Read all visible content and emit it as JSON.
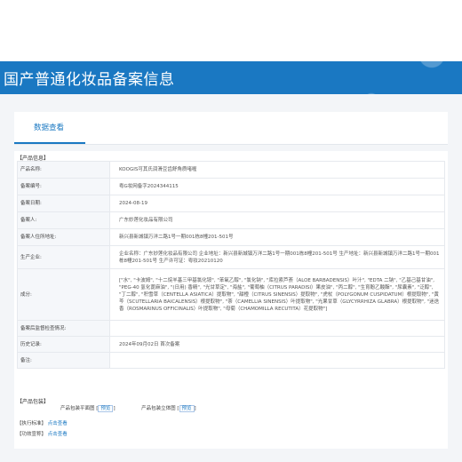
{
  "header": {
    "title": "国产普通化妆品备案信息"
  },
  "tab": {
    "label": "数据查看"
  },
  "sections": {
    "product_info": "【产品信息】",
    "packaging": "【产品包装】",
    "standard": "【执行标准】",
    "efficacy": "【功效宣称】"
  },
  "info_rows": [
    {
      "label": "产品名称:",
      "value": "KOOGIS可其氏润滑豆齿舒角质啫喱"
    },
    {
      "label": "备案编号:",
      "value": "粤G妆网备字2024344115"
    },
    {
      "label": "备案日期:",
      "value": "2024-08-19"
    },
    {
      "label": "备案人:",
      "value": "广东妙莲化妆品有限公司"
    },
    {
      "label": "备案人住所地址:",
      "value": "新兴县新城镇万洋二路1号一期001栋8幢201-501号"
    },
    {
      "label": "生产企业:",
      "value": "企业名称：广东妙莲化妆品有限公司 企业地址：新兴县新城镇万洋二路1号一期001栋8幢201-501号 生产地址：新兴县新城镇万洋二路1号一期001栋8幢201-501号 生产许可证：粤妆20210120"
    },
    {
      "label": "成分:",
      "value": "[\"水\", \"卡波姆\", \"十二烷羊基三甲基氯化铵\", \"苯氧乙醇\", \"氯化钠\", \"库拉索芦荟（ALOE BARBADENSIS）叶汁\", \"EDTA 二钠\", \"乙基己基甘油\", \"PEG-40 氢化蓖麻油\", \"(日用) 香精\", \"光甘草定\", \"海盐\", \"葡萄柚（CITRUS PARADISI）果皮油\", \"丙二醇\", \"生育酚乙酸酯\", \"尿囊素\", \"泛醇\", \"丁二醇\", \"积雪草（CENTELLA ASIATICA）提取物\", \"甜橙（CITRUS SINENSIS）提取物\", \"虎杖（POLYGONUM CUSPIDATUM）根提取物\", \"黄芩（SCUTELLARIA BAICALENSIS）根提取物\", \"茶（CAMELLIA SINENSIS）叶提取物\", \"光果甘草（GLYCYRRHIZA GLABRA）根提取物\", \"迷迭香（ROSMARINUS OFFICINALIS）叶提取物\", \"母菊（CHAMOMILLA RECUTITA）花提取物\"]"
    },
    {
      "label": "备案后监督检查情况:",
      "value": ""
    },
    {
      "label": "历史记录:",
      "value": "2024年09月02日 首次备案"
    },
    {
      "label": "备注:",
      "value": ""
    }
  ],
  "packaging": {
    "flat_label": "产品包装平面图",
    "flat_link": "预览",
    "solid_label": "产品包装立体图",
    "solid_link": "预览"
  },
  "standard": {
    "link": "点击查看"
  },
  "efficacy": {
    "link": "点击查看"
  }
}
